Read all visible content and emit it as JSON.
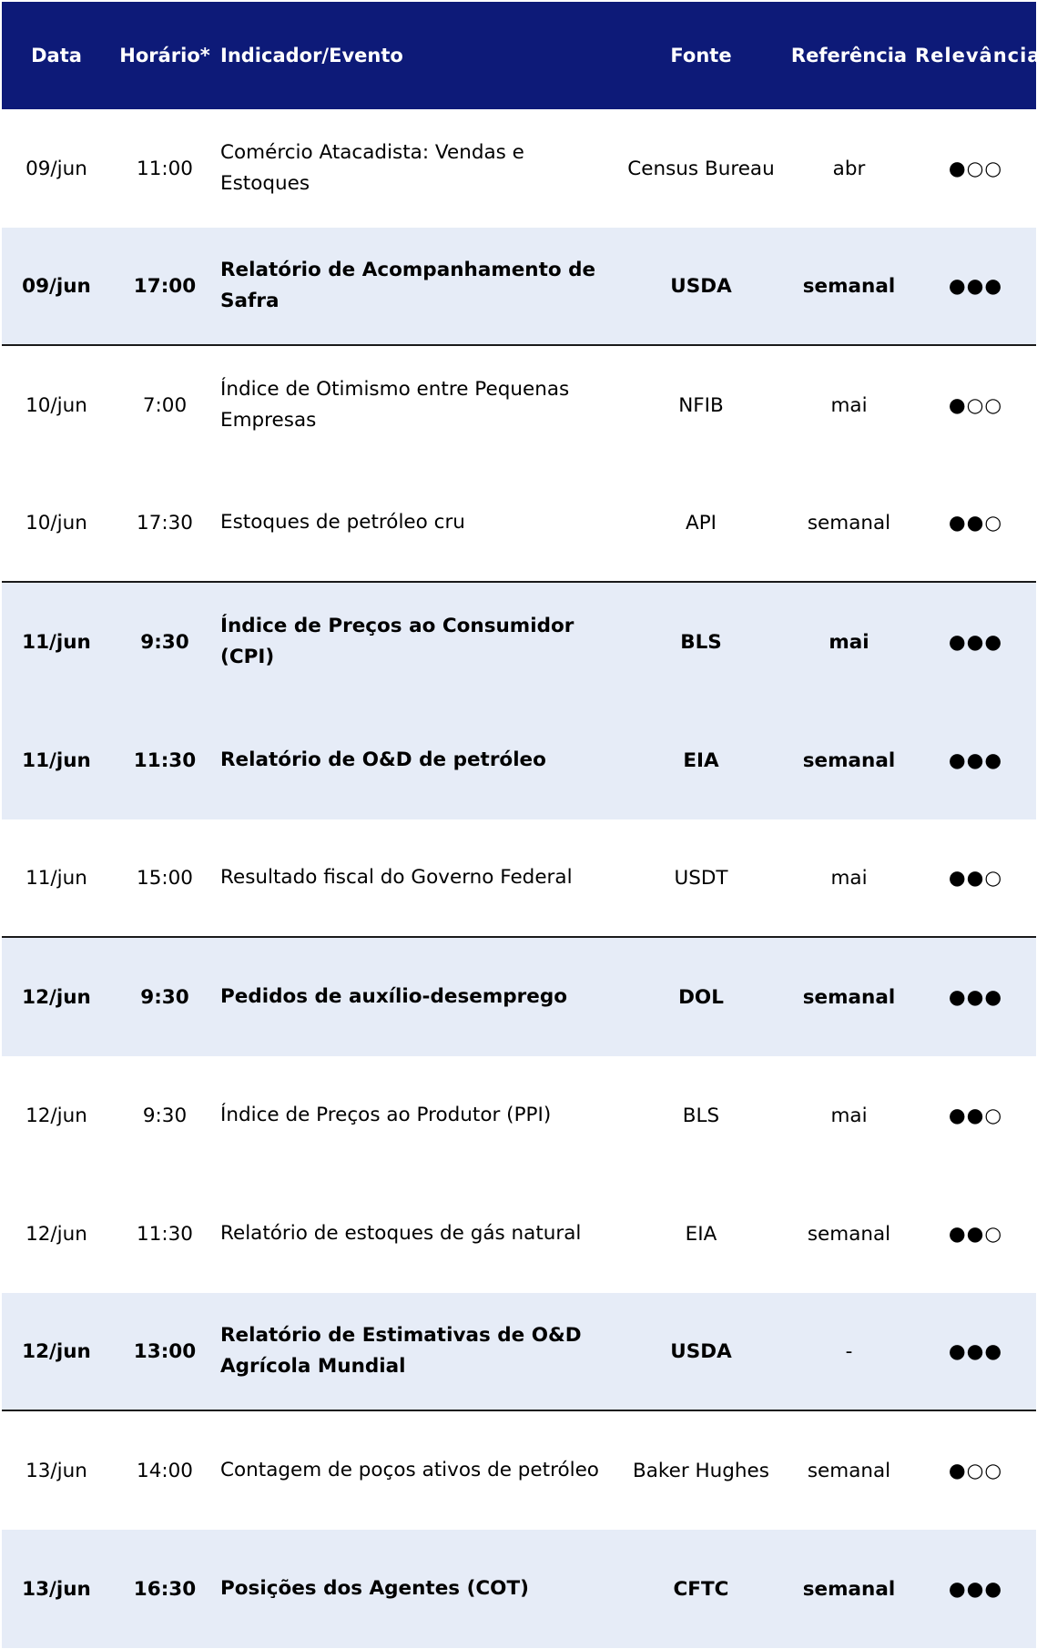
{
  "headers": {
    "date": "Data",
    "time": "Horário*",
    "event": "Indicador/Evento",
    "source": "Fonte",
    "reference": "Referência",
    "relevance": "Relevância"
  },
  "rows": [
    {
      "date": "09/jun",
      "time": "11:00",
      "event": "Comércio Atacadista: Vendas e Estoques",
      "source": "Census Bureau",
      "reference": "abr",
      "relevance": "●○○"
    },
    {
      "date": "09/jun",
      "time": "17:00",
      "event": "Relatório de Acompanhamento de Safra",
      "source": "USDA",
      "reference": "semanal",
      "relevance": "●●●"
    },
    {
      "date": "10/jun",
      "time": "7:00",
      "event": "Índice de Otimismo entre Pequenas Empresas",
      "source": "NFIB",
      "reference": "mai",
      "relevance": "●○○"
    },
    {
      "date": "10/jun",
      "time": "17:30",
      "event": "Estoques de petróleo cru",
      "source": "API",
      "reference": "semanal",
      "relevance": "●●○"
    },
    {
      "date": "11/jun",
      "time": "9:30",
      "event": "Índice de Preços ao Consumidor (CPI)",
      "source": "BLS",
      "reference": "mai",
      "relevance": "●●●"
    },
    {
      "date": "11/jun",
      "time": "11:30",
      "event": "Relatório de O&D de petróleo",
      "source": "EIA",
      "reference": "semanal",
      "relevance": "●●●"
    },
    {
      "date": "11/jun",
      "time": "15:00",
      "event": "Resultado fiscal do Governo Federal",
      "source": "USDT",
      "reference": "mai",
      "relevance": "●●○"
    },
    {
      "date": "12/jun",
      "time": "9:30",
      "event": "Pedidos de auxílio-desemprego",
      "source": "DOL",
      "reference": "semanal",
      "relevance": "●●●"
    },
    {
      "date": "12/jun",
      "time": "9:30",
      "event": "Índice de Preços ao Produtor (PPI)",
      "source": "BLS",
      "reference": "mai",
      "relevance": "●●○"
    },
    {
      "date": "12/jun",
      "time": "11:30",
      "event": "Relatório de estoques de gás natural",
      "source": "EIA",
      "reference": "semanal",
      "relevance": "●●○"
    },
    {
      "date": "12/jun",
      "time": "13:00",
      "event": "Relatório de Estimativas de O&D Agrícola Mundial",
      "source": "USDA",
      "reference": "-",
      "relevance": "●●●"
    },
    {
      "date": "13/jun",
      "time": "14:00",
      "event": "Contagem de poços ativos de petróleo",
      "source": "Baker Hughes",
      "reference": "semanal",
      "relevance": "●○○"
    },
    {
      "date": "13/jun",
      "time": "16:30",
      "event": "Posições dos Agentes (COT)",
      "source": "CFTC",
      "reference": "semanal",
      "relevance": "●●●"
    }
  ]
}
